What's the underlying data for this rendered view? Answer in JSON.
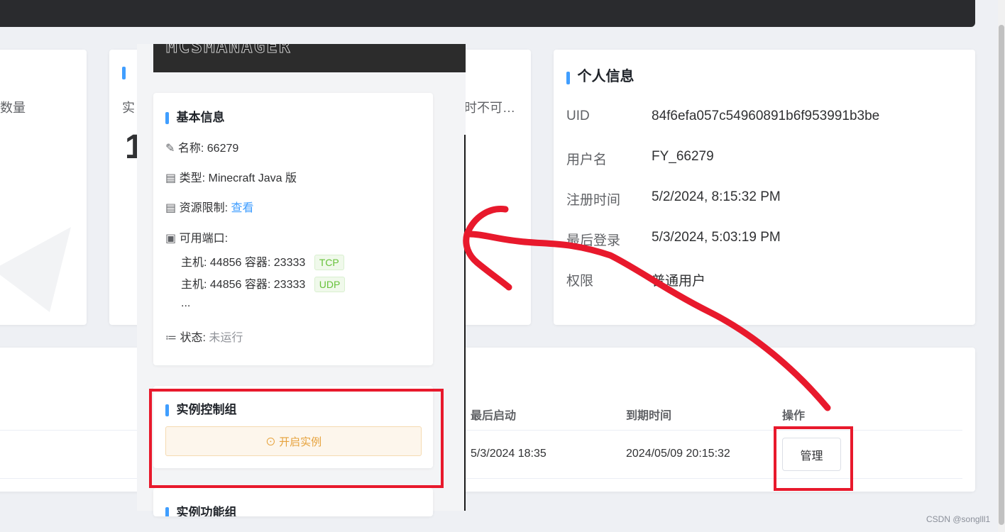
{
  "left_cards": {
    "card1_label_fragment": "数量",
    "card2_label_fragment": "实",
    "card2_value_fragment": "1",
    "card3_label_fragment": "时不可…"
  },
  "banner": {
    "logo_text": "MCSMANAGER"
  },
  "basic_info": {
    "title": "基本信息",
    "name_label": "名称:",
    "name_value": "66279",
    "type_label": "类型:",
    "type_value": "Minecraft Java 版",
    "resource_label": "资源限制:",
    "resource_link": "查看",
    "ports_label": "可用端口:",
    "ports": [
      {
        "host_label": "主机:",
        "host": "44856",
        "container_label": "容器:",
        "container": "23333",
        "proto": "TCP"
      },
      {
        "host_label": "主机:",
        "host": "44856",
        "container_label": "容器:",
        "container": "23333",
        "proto": "UDP"
      }
    ],
    "ports_more": "...",
    "status_label": "状态:",
    "status_value": "未运行"
  },
  "control_group": {
    "title": "实例控制组",
    "start_button": "开启实例"
  },
  "function_group": {
    "title": "实例功能组"
  },
  "profile": {
    "title": "个人信息",
    "rows": [
      {
        "label": "UID",
        "value": "84f6efa057c54960891b6f953991b3be"
      },
      {
        "label": "用户名",
        "value": "FY_66279"
      },
      {
        "label": "注册时间",
        "value": "5/2/2024, 8:15:32 PM"
      },
      {
        "label": "最后登录",
        "value": "5/3/2024, 5:03:19 PM"
      },
      {
        "label": "权限",
        "value": "普通用户"
      }
    ]
  },
  "table": {
    "headers": [
      "最后启动",
      "到期时间",
      "操作"
    ],
    "row": {
      "last_start": "5/3/2024 18:35",
      "expire": "2024/05/09 20:15:32",
      "action": "管理"
    }
  },
  "watermark": "CSDN @songlll1",
  "colors": {
    "accent": "#409eff",
    "annotation_red": "#e8192c",
    "warning_bg": "#fdf6ec",
    "warning_text": "#e6a23c"
  }
}
